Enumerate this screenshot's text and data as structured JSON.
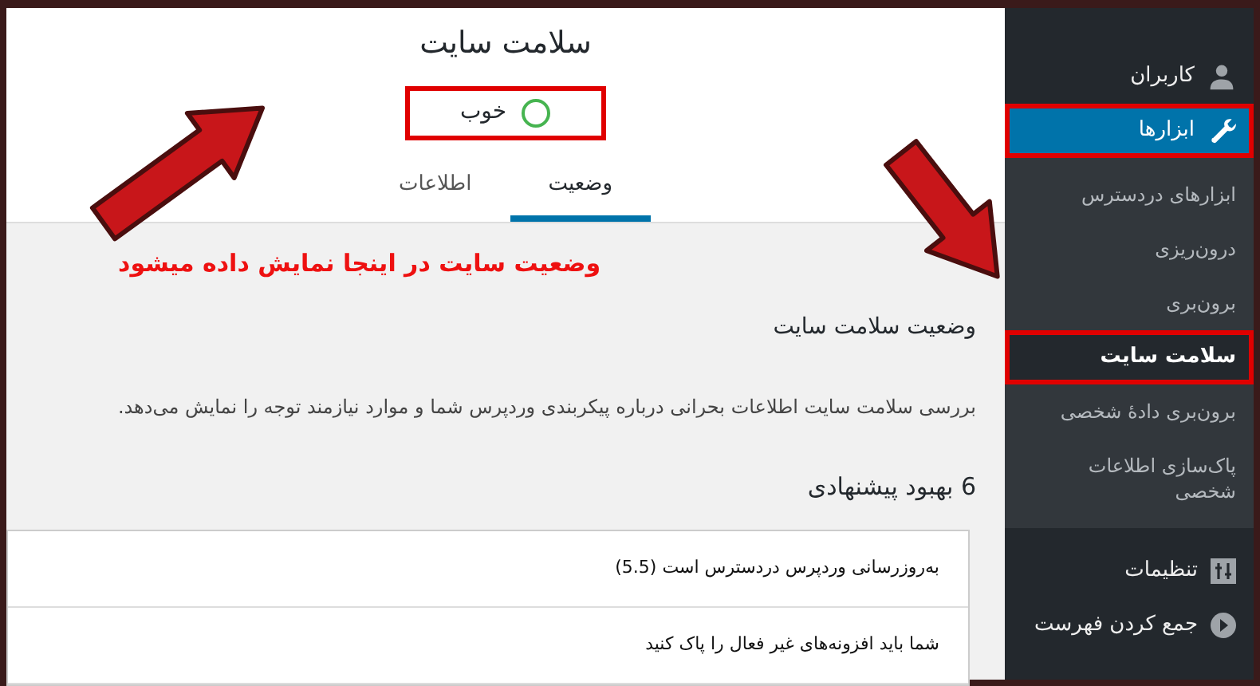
{
  "page": {
    "title": "سلامت سایت",
    "status": {
      "label": "خوب",
      "highlighted": true
    },
    "tabs": [
      {
        "label": "وضعیت",
        "selected": true
      },
      {
        "label": "اطلاعات",
        "selected": false
      }
    ]
  },
  "annotation": {
    "text": "وضعیت سایت در اینجا نمایش داده میشود"
  },
  "section": {
    "heading": "وضعیت سلامت سایت",
    "description": "بررسی سلامت سایت اطلاعات بحرانی درباره پیکربندی وردپرس شما و موارد نیازمند توجه را نمایش می‌دهد.",
    "improvements_heading": "6 بهبود پیشنهادی",
    "items": [
      "به‌روزرسانی وردپرس دردسترس است (5.5)",
      "شما باید افزونه‌های غیر فعال را پاک کنید"
    ]
  },
  "sidebar": {
    "items": [
      {
        "label": "کاربران",
        "kind": "user",
        "selected": false,
        "highlighted": false
      },
      {
        "label": "ابزارها",
        "kind": "tools",
        "selected": true,
        "highlighted": true,
        "children": [
          {
            "label": "ابزارهای دردسترس",
            "selected": false,
            "highlighted": false
          },
          {
            "label": "درون‌ریزی",
            "selected": false,
            "highlighted": false
          },
          {
            "label": "برون‌بری",
            "selected": false,
            "highlighted": false
          },
          {
            "label": "سلامت سایت",
            "selected": true,
            "highlighted": true
          },
          {
            "label": "برون‌بری دادهٔ شخصی",
            "selected": false,
            "highlighted": false
          },
          {
            "label": "پاک‌سازی اطلاعات شخصی",
            "selected": false,
            "highlighted": false
          }
        ]
      },
      {
        "label": "تنظیمات",
        "kind": "settings",
        "selected": false,
        "highlighted": false
      },
      {
        "label": "جمع کردن فهرست",
        "kind": "collapse",
        "selected": false,
        "highlighted": false
      }
    ]
  }
}
